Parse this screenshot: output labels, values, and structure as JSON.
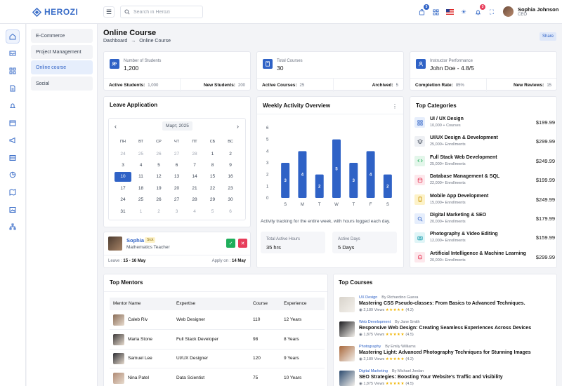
{
  "brand": {
    "name": "HEROZI"
  },
  "header": {
    "search_placeholder": "Search in Herozi",
    "cart_badge": "5",
    "notify_badge": "3",
    "user_name": "Sophia Johnson",
    "user_role": "CEO"
  },
  "subnav": {
    "items": [
      "E-Commerce",
      "Project Management",
      "Online course",
      "Social"
    ]
  },
  "page": {
    "title": "Online Course",
    "crumb_root": "Dashboard",
    "crumb_sep": "→",
    "crumb_current": "Online Course",
    "share": "Share"
  },
  "stats": [
    {
      "label": "Number of Students",
      "value": "1,200",
      "left_label": "Active Students:",
      "left_value": "1,000",
      "right_label": "New Students:",
      "right_value": "200"
    },
    {
      "label": "Total Courses",
      "value": "30",
      "left_label": "Active Courses:",
      "left_value": "25",
      "right_label": "Archived:",
      "right_value": "5"
    },
    {
      "label": "Instructor Performance",
      "value": "John Doe - 4.8/5",
      "left_label": "Completion Rate:",
      "left_value": "85%",
      "right_label": "New Reviews:",
      "right_value": "15"
    }
  ],
  "leave": {
    "title": "Leave Application",
    "month": "Март, 2025",
    "prev": "‹",
    "next": "›",
    "weekdays": [
      "ПН",
      "ВТ",
      "СР",
      "ЧТ",
      "ПТ",
      "СБ",
      "ВС"
    ],
    "days": [
      [
        "24",
        "25",
        "26",
        "27",
        "28",
        "1",
        "2"
      ],
      [
        "3",
        "4",
        "5",
        "6",
        "7",
        "8",
        "9"
      ],
      [
        "10",
        "11",
        "12",
        "13",
        "14",
        "15",
        "16"
      ],
      [
        "17",
        "18",
        "19",
        "20",
        "21",
        "22",
        "23"
      ],
      [
        "24",
        "25",
        "26",
        "27",
        "28",
        "29",
        "30"
      ],
      [
        "31",
        "1",
        "2",
        "3",
        "4",
        "5",
        "6"
      ]
    ],
    "selected": "10",
    "applicant": {
      "name": "Sophia",
      "tag": "Sick",
      "role": "Mathematics Teacher",
      "leave_label": "Leave : ",
      "leave_value": "15 - 16 May",
      "apply_label": "Apply on : ",
      "apply_value": "14 May",
      "approve": "✓",
      "reject": "✕"
    }
  },
  "activity": {
    "title": "Weekly Activity Overview",
    "menu": "⋮",
    "note": "Activity tracking for the entire week, with hours logged each day.",
    "total_label": "Total Active Hours",
    "total_value": "35 hrs",
    "days_label": "Active Days",
    "days_value": "5 Days",
    "chart_data": {
      "type": "bar",
      "categories": [
        "S",
        "M",
        "T",
        "W",
        "T",
        "F",
        "S"
      ],
      "values": [
        3,
        4,
        2,
        5,
        3,
        4,
        2
      ],
      "ylim": [
        0,
        6
      ],
      "yticks": [
        0,
        1,
        2,
        3,
        4,
        5,
        6
      ],
      "data_labels": true,
      "grid": false,
      "color": "#2f62c6"
    }
  },
  "categories": {
    "title": "Top Categories",
    "items": [
      {
        "name": "UI / UX Design",
        "sub": "10,000 + Courses",
        "price": "$199.99",
        "icon": "grid-icon",
        "bg": "#e6eefc",
        "fg": "#2f62c6"
      },
      {
        "name": "UI/UX Design & Development",
        "sub": "25,000+ Enrollments",
        "price": "$299.99",
        "icon": "layers-icon",
        "bg": "#eef0f4",
        "fg": "#4b5563"
      },
      {
        "name": "Full Stack Web Development",
        "sub": "25,000+ Enrollments",
        "price": "$249.99",
        "icon": "code-icon",
        "bg": "#e3f6ea",
        "fg": "#1fae5b"
      },
      {
        "name": "Database Management & SQL",
        "sub": "22,000+ Enrollments",
        "price": "$199.99",
        "icon": "database-icon",
        "bg": "#fde8ec",
        "fg": "#e73d5a"
      },
      {
        "name": "Mobile App Development",
        "sub": "15,000+ Enrollments",
        "price": "$249.99",
        "icon": "phone-icon",
        "bg": "#fdf2c8",
        "fg": "#c99400"
      },
      {
        "name": "Digital Marketing & SEO",
        "sub": "20,000+ Enrollments",
        "price": "$179.99",
        "icon": "search-icon",
        "bg": "#e6eefc",
        "fg": "#2f62c6"
      },
      {
        "name": "Photography & Video Editing",
        "sub": "12,000+ Enrollments",
        "price": "$159.99",
        "icon": "camera-icon",
        "bg": "#e0f5f7",
        "fg": "#1a9fb0"
      },
      {
        "name": "Artificial Intelligence & Machine Learning",
        "sub": "20,000+ Enrollments",
        "price": "$299.99",
        "icon": "robot-icon",
        "bg": "#fde8ec",
        "fg": "#e73d5a"
      }
    ]
  },
  "mentors": {
    "title": "Top Mentors",
    "headers": [
      "Mentor Name",
      "Expertise",
      "Course",
      "Experience"
    ],
    "rows": [
      {
        "name": "Caleb Riv",
        "expertise": "Web Designer",
        "course": "110",
        "experience": "12 Years",
        "tone": "#8a6d57"
      },
      {
        "name": "Maria Stone",
        "expertise": "Full Stack Developer",
        "course": "98",
        "experience": "8 Years",
        "tone": "#3d3a3a"
      },
      {
        "name": "Samuel Lee",
        "expertise": "UI/UX Designer",
        "course": "120",
        "experience": "9 Years",
        "tone": "#2d2e33"
      },
      {
        "name": "Nina Patel",
        "expertise": "Data Scientist",
        "course": "75",
        "experience": "10 Years",
        "tone": "#b08a74"
      }
    ]
  },
  "courses": {
    "title": "Top Courses",
    "items": [
      {
        "category": "UX Design",
        "by": "By Richardino Gueva",
        "title": "Mastering CSS Pseudo-classes: From Basics to Advanced Techniques.",
        "views": "2,189 Views",
        "stars": "★★★★★",
        "rating": "(4.2)",
        "tone": "#d8d3cb"
      },
      {
        "category": "Web Development",
        "by": "By Jane Smith",
        "title": "Responsive Web Design: Creating Seamless Experiences Across Devices",
        "views": "1,875 Views",
        "stars": "★★★★★",
        "rating": "(4.5)",
        "tone": "#1b1b1f"
      },
      {
        "category": "Photography",
        "by": "By Emily Williams",
        "title": "Mastering Light: Advanced Photography Techniques for Stunning Images",
        "views": "2,189 Views",
        "stars": "★★★★★",
        "rating": "(4.2)",
        "tone": "#a8673b"
      },
      {
        "category": "Digital Marketing",
        "by": "By Michael Jordan",
        "title": "SEO Strategies: Boosting Your Website's Traffic and Visibility",
        "views": "1,875 Views",
        "stars": "★★★★★",
        "rating": "(4.5)",
        "tone": "#2b4a6e"
      }
    ]
  }
}
